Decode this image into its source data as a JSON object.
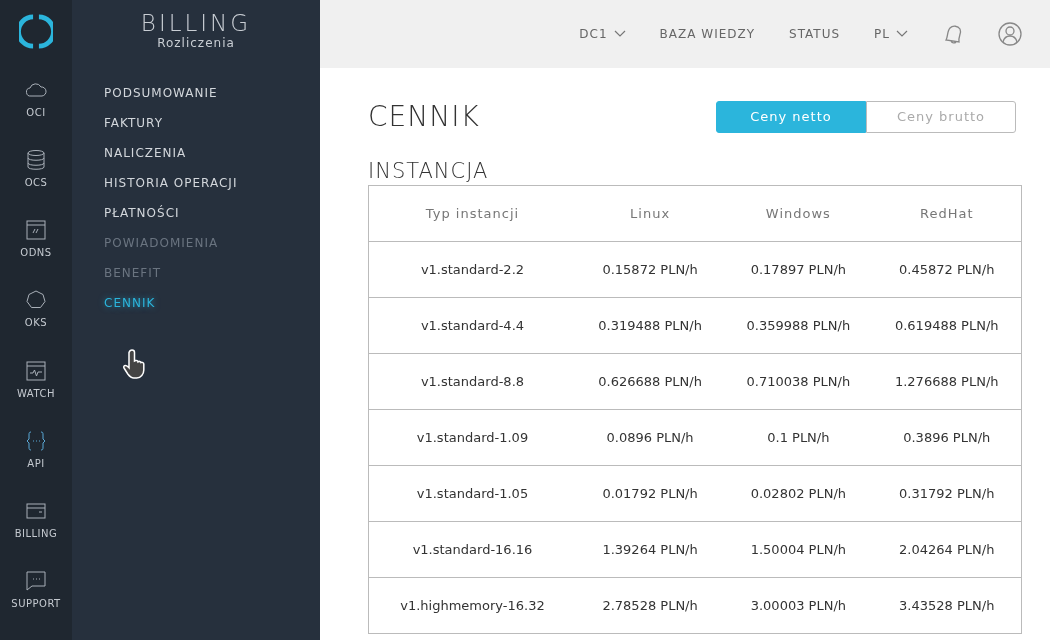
{
  "rail": [
    {
      "label": "OCI"
    },
    {
      "label": "OCS"
    },
    {
      "label": "ODNS"
    },
    {
      "label": "OKS"
    },
    {
      "label": "WATCH"
    },
    {
      "label": "API"
    },
    {
      "label": "BILLING"
    },
    {
      "label": "SUPPORT"
    }
  ],
  "sidebar": {
    "title": "BILLING",
    "subtitle": "Rozliczenia",
    "items": [
      {
        "label": "PODSUMOWANIE",
        "selected": false,
        "disabled": false
      },
      {
        "label": "FAKTURY",
        "selected": false,
        "disabled": false
      },
      {
        "label": "NALICZENIA",
        "selected": false,
        "disabled": false
      },
      {
        "label": "HISTORIA OPERACJI",
        "selected": false,
        "disabled": false
      },
      {
        "label": "PŁATNOŚCI",
        "selected": false,
        "disabled": false
      },
      {
        "label": "POWIADOMIENIA",
        "selected": false,
        "disabled": true
      },
      {
        "label": "BENEFIT",
        "selected": false,
        "disabled": true
      },
      {
        "label": "CENNIK",
        "selected": true,
        "disabled": false
      }
    ]
  },
  "topbar": [
    {
      "label": "DC1",
      "dropdown": true
    },
    {
      "label": "BAZA WIEDZY",
      "dropdown": false
    },
    {
      "label": "STATUS",
      "dropdown": false
    },
    {
      "label": "PL",
      "dropdown": true
    }
  ],
  "page_title": "CENNIK",
  "price_toggle": [
    {
      "label": "Ceny netto",
      "selected": true
    },
    {
      "label": "Ceny brutto",
      "selected": false
    }
  ],
  "section_title": "INSTANCJA",
  "table": {
    "columns": [
      "Typ instancji",
      "Linux",
      "Windows",
      "RedHat"
    ],
    "rows": [
      [
        "v1.standard-2.2",
        "0.15872 PLN/h",
        "0.17897 PLN/h",
        "0.45872 PLN/h"
      ],
      [
        "v1.standard-4.4",
        "0.319488 PLN/h",
        "0.359988 PLN/h",
        "0.619488 PLN/h"
      ],
      [
        "v1.standard-8.8",
        "0.626688 PLN/h",
        "0.710038 PLN/h",
        "1.276688 PLN/h"
      ],
      [
        "v1.standard-1.09",
        "0.0896 PLN/h",
        "0.1 PLN/h",
        "0.3896 PLN/h"
      ],
      [
        "v1.standard-1.05",
        "0.01792 PLN/h",
        "0.02802 PLN/h",
        "0.31792 PLN/h"
      ],
      [
        "v1.standard-16.16",
        "1.39264 PLN/h",
        "1.50004 PLN/h",
        "2.04264 PLN/h"
      ],
      [
        "v1.highmemory-16.32",
        "2.78528 PLN/h",
        "3.00003 PLN/h",
        "3.43528 PLN/h"
      ]
    ]
  }
}
